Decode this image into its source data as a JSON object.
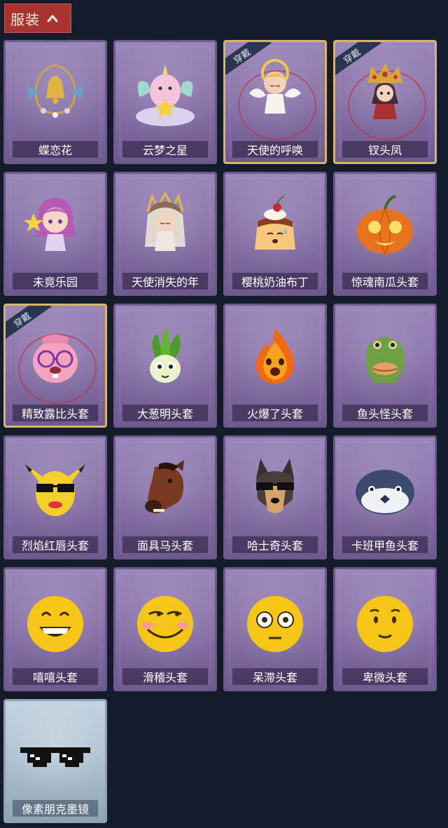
{
  "header": {
    "title": "服装",
    "expand_icon": "chevron-up-icon"
  },
  "badge_text": "穿戴",
  "items": [
    {
      "name": "蝶恋花",
      "icon": "butterfly-bell-ornament",
      "worn": false
    },
    {
      "name": "云梦之星",
      "icon": "unicorn-on-cloud",
      "worn": false
    },
    {
      "name": "天使的呼唤",
      "icon": "angel-cherub",
      "worn": true
    },
    {
      "name": "钗头凤",
      "icon": "phoenix-crown-figure",
      "worn": true
    },
    {
      "name": "未竟乐园",
      "icon": "pink-hair-doll",
      "worn": false
    },
    {
      "name": "天使消失的年",
      "icon": "veiled-angel-doll",
      "worn": false
    },
    {
      "name": "樱桃奶油布丁",
      "icon": "cherry-pudding",
      "worn": false
    },
    {
      "name": "惊魂南瓜头套",
      "icon": "jack-o-lantern",
      "worn": false
    },
    {
      "name": "精致露比头套",
      "icon": "pink-beaver-glasses",
      "worn": true
    },
    {
      "name": "大葱明头套",
      "icon": "green-onion",
      "worn": false
    },
    {
      "name": "火爆了头套",
      "icon": "fire-spirit",
      "worn": false
    },
    {
      "name": "鱼头怪头套",
      "icon": "fish-head-mask",
      "worn": false
    },
    {
      "name": "烈焰红唇头套",
      "icon": "yellow-mouse-sunglasses",
      "worn": false
    },
    {
      "name": "面具马头套",
      "icon": "horse-head-mask",
      "worn": false
    },
    {
      "name": "哈士奇头套",
      "icon": "husky-sunglasses",
      "worn": false
    },
    {
      "name": "卡班甲鱼头套",
      "icon": "round-fish",
      "worn": false
    },
    {
      "name": "嘻嘻头套",
      "icon": "grinning-emoji",
      "worn": false
    },
    {
      "name": "滑稽头套",
      "icon": "sly-smile-emoji",
      "worn": false
    },
    {
      "name": "呆滞头套",
      "icon": "dazed-emoji",
      "worn": false
    },
    {
      "name": "卑微头套",
      "icon": "timid-emoji",
      "worn": false
    },
    {
      "name": "像素朋克墨镜",
      "icon": "pixel-sunglasses",
      "worn": false,
      "tier": "silver"
    }
  ]
}
